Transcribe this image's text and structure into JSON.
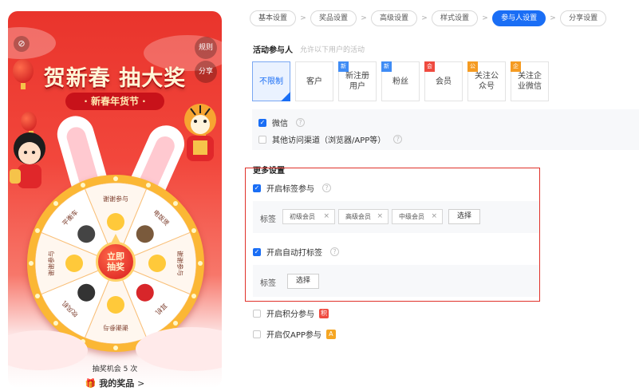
{
  "preview": {
    "headline": "贺新春 抽大奖",
    "subhead": "· 新春年货节 ·",
    "rules_label": "规则",
    "share_label": "分享",
    "center_button": [
      "立即",
      "抽奖"
    ],
    "prizes": [
      "谢谢参与",
      "电饭煲",
      "谢谢参与",
      "耳机",
      "谢谢参与",
      "吹风机",
      "谢谢参与",
      "平衡车"
    ],
    "chances_text": "抽奖机会 5 次",
    "my_prizes": "我的奖品",
    "my_prizes_arrow": ">"
  },
  "steps": [
    {
      "label": "基本设置",
      "active": false
    },
    {
      "label": "奖品设置",
      "active": false
    },
    {
      "label": "高级设置",
      "active": false
    },
    {
      "label": "样式设置",
      "active": false
    },
    {
      "label": "参与人设置",
      "active": true
    },
    {
      "label": "分享设置",
      "active": false
    }
  ],
  "step_arrow": ">",
  "participants": {
    "title": "活动参与人",
    "hint": "允许以下用户的活动",
    "options": [
      {
        "label": "不限制",
        "selected": true,
        "corner": "",
        "corner_color": ""
      },
      {
        "label": "客户",
        "selected": false,
        "corner": "",
        "corner_color": ""
      },
      {
        "label": "新注册用户",
        "selected": false,
        "corner": "新",
        "corner_color": "blue"
      },
      {
        "label": "粉丝",
        "selected": false,
        "corner": "新",
        "corner_color": "blue"
      },
      {
        "label": "会员",
        "selected": false,
        "corner": "会",
        "corner_color": "red"
      },
      {
        "label": "关注公众号",
        "selected": false,
        "corner": "公",
        "corner_color": "orange"
      },
      {
        "label": "关注企业微信",
        "selected": false,
        "corner": "企",
        "corner_color": "orange"
      }
    ]
  },
  "channels": [
    {
      "label": "微信",
      "checked": true
    },
    {
      "label": "其他访问渠道（浏览器/APP等）",
      "checked": false
    }
  ],
  "more": {
    "title": "更多设置",
    "tag_participation": {
      "label": "开启标签参与",
      "checked": true
    },
    "tag_field_label": "标签",
    "tags": [
      "初级会员",
      "高级会员",
      "中级会员"
    ],
    "tag_remove": "×",
    "pick_button": "选择",
    "auto_tag": {
      "label": "开启自动打标签",
      "checked": true
    },
    "auto_tag_field_label": "标签",
    "auto_pick_button": "选择",
    "points": {
      "label": "开启积分参与",
      "checked": false,
      "badge": "积"
    },
    "app_only": {
      "label": "开启仅APP参与",
      "checked": false,
      "badge": "A"
    }
  },
  "check_mark": "✓",
  "help_mark": "?",
  "compass_icon": "compass-icon"
}
